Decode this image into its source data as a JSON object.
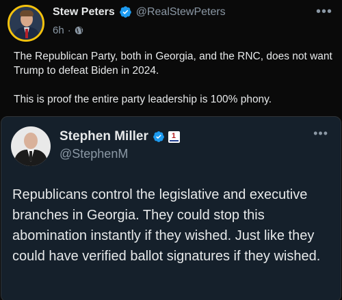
{
  "post": {
    "author": {
      "name": "Stew Peters",
      "handle": "@RealStewPeters",
      "verified": true
    },
    "time": "6h",
    "separator": "·",
    "text": [
      "The Republican Party, both in Georgia, and the RNC, does not want Trump to defeat Biden in 2024.",
      "This is proof the entire party leadership is 100% phony."
    ],
    "more_label": "•••"
  },
  "quoted_post": {
    "author": {
      "name": "Stephen Miller",
      "handle": "@StephenM",
      "verified": true,
      "affiliation_badge": "1"
    },
    "text": "Republicans control the legislative and executive branches in Georgia. They could stop this abomination instantly if they wished. Just like they could have verified ballot signatures if they wished.",
    "more_label": "•••"
  },
  "colors": {
    "background": "#0a0a0a",
    "quote_background": "#15202b",
    "text": "#e7e9ea",
    "secondary_text": "#8b98a5",
    "verified": "#1d9bf0",
    "avatar_ring": "#f4c20d"
  },
  "icons": [
    "verified-badge-icon",
    "globe-icon",
    "more-options-icon",
    "affiliation-badge-icon"
  ]
}
